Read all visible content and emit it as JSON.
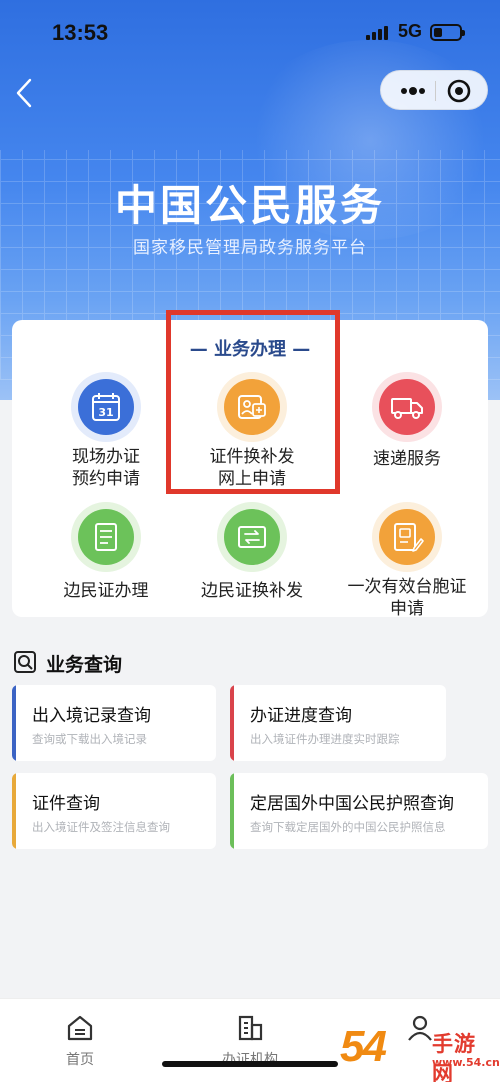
{
  "status_bar": {
    "time": "13:53",
    "network": "5G"
  },
  "header": {
    "title": "中国公民服务",
    "subtitle": "国家移民管理局政务服务平台"
  },
  "services": {
    "section_title": "— 业务办理 —",
    "items": [
      {
        "label_line1": "现场办证",
        "label_line2": "预约申请",
        "icon": "calendar-icon",
        "color": "#3b6fd8"
      },
      {
        "label_line1": "证件换补发",
        "label_line2": "网上申请",
        "icon": "id-card-icon",
        "color": "#f2a23a"
      },
      {
        "label_line1": "速递服务",
        "label_line2": "",
        "icon": "truck-icon",
        "color": "#e8505b"
      },
      {
        "label_line1": "边民证办理",
        "label_line2": "",
        "icon": "document-icon",
        "color": "#6cc25a"
      },
      {
        "label_line1": "边民证换补发",
        "label_line2": "",
        "icon": "card-swap-icon",
        "color": "#6cc25a"
      },
      {
        "label_line1": "一次有效台胞证",
        "label_line2": "申请",
        "icon": "edit-doc-icon",
        "color": "#f2a23a"
      }
    ]
  },
  "query": {
    "section_title": "业务查询",
    "items": [
      {
        "title": "出入境记录查询",
        "desc": "查询或下载出入境记录",
        "color": "#3b63c4"
      },
      {
        "title": "办证进度查询",
        "desc": "出入境证件办理进度实时跟踪",
        "color": "#d9434b"
      },
      {
        "title": "证件查询",
        "desc": "出入境证件及签注信息查询",
        "color": "#e8a93a"
      },
      {
        "title": "定居国外中国公民护照查询",
        "desc": "查询下载定居国外的中国公民护照信息",
        "color": "#6cbf5a"
      }
    ]
  },
  "tabbar": {
    "items": [
      {
        "label": "首页",
        "icon": "home-icon"
      },
      {
        "label": "办证机构",
        "icon": "building-icon"
      },
      {
        "label": "",
        "icon": "user-icon"
      }
    ]
  },
  "watermark": {
    "number": "54",
    "brand": "手游网",
    "url": "www.54.cn"
  }
}
